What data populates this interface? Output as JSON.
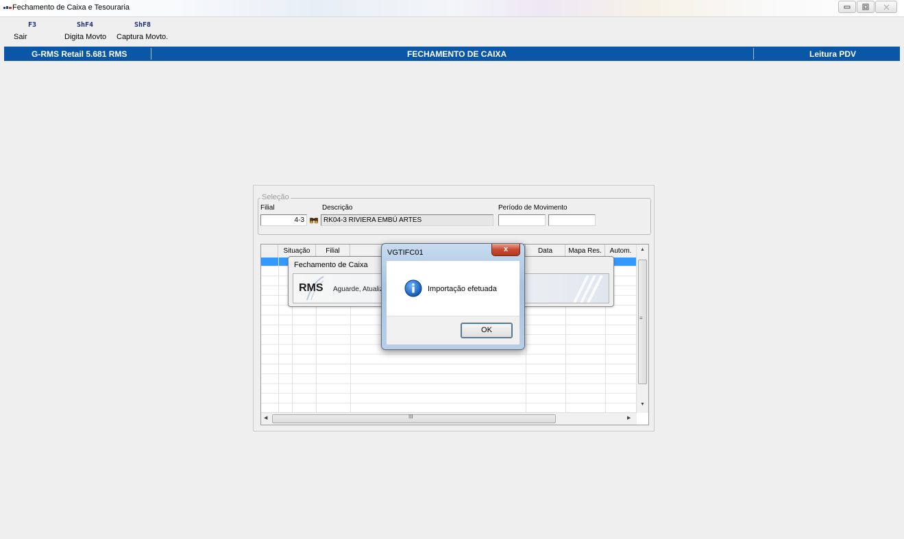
{
  "window": {
    "title": "Fechamento de Caixa e Tesouraria",
    "controls": [
      "minimize",
      "restore",
      "close"
    ]
  },
  "function_keys": [
    {
      "key": "F3",
      "label": "Sair"
    },
    {
      "key": "ShF4",
      "label": "Digita Movto"
    },
    {
      "key": "ShF8",
      "label": "Captura Movto."
    }
  ],
  "header_bar": {
    "left": "G-RMS Retail 5.681 RMS",
    "center": "FECHAMENTO DE CAIXA",
    "right": "Leitura PDV",
    "color": "#0a57a8"
  },
  "selection": {
    "legend": "Seleção",
    "filial_label": "Filial",
    "filial_value": "4-3",
    "descricao_label": "Descrição",
    "descricao_value": "RK04-3 RIVIERA EMBÚ ARTES",
    "periodo_label": "Período de Movimento",
    "periodo_inicio": "",
    "periodo_fim": ""
  },
  "grid": {
    "columns": [
      "Situação",
      "Filial",
      "",
      "Data",
      "Mapa Res.",
      "Autom."
    ],
    "scroll_marker": "III"
  },
  "progress_dialog": {
    "title": "Fechamento de Caixa",
    "logo": "RMS",
    "message": "Aguarde, Atualiz"
  },
  "message_box": {
    "title": "VGTIFC01",
    "close_glyph": "x",
    "icon": "info-icon",
    "message": "Importação efetuada",
    "ok_label": "OK"
  }
}
